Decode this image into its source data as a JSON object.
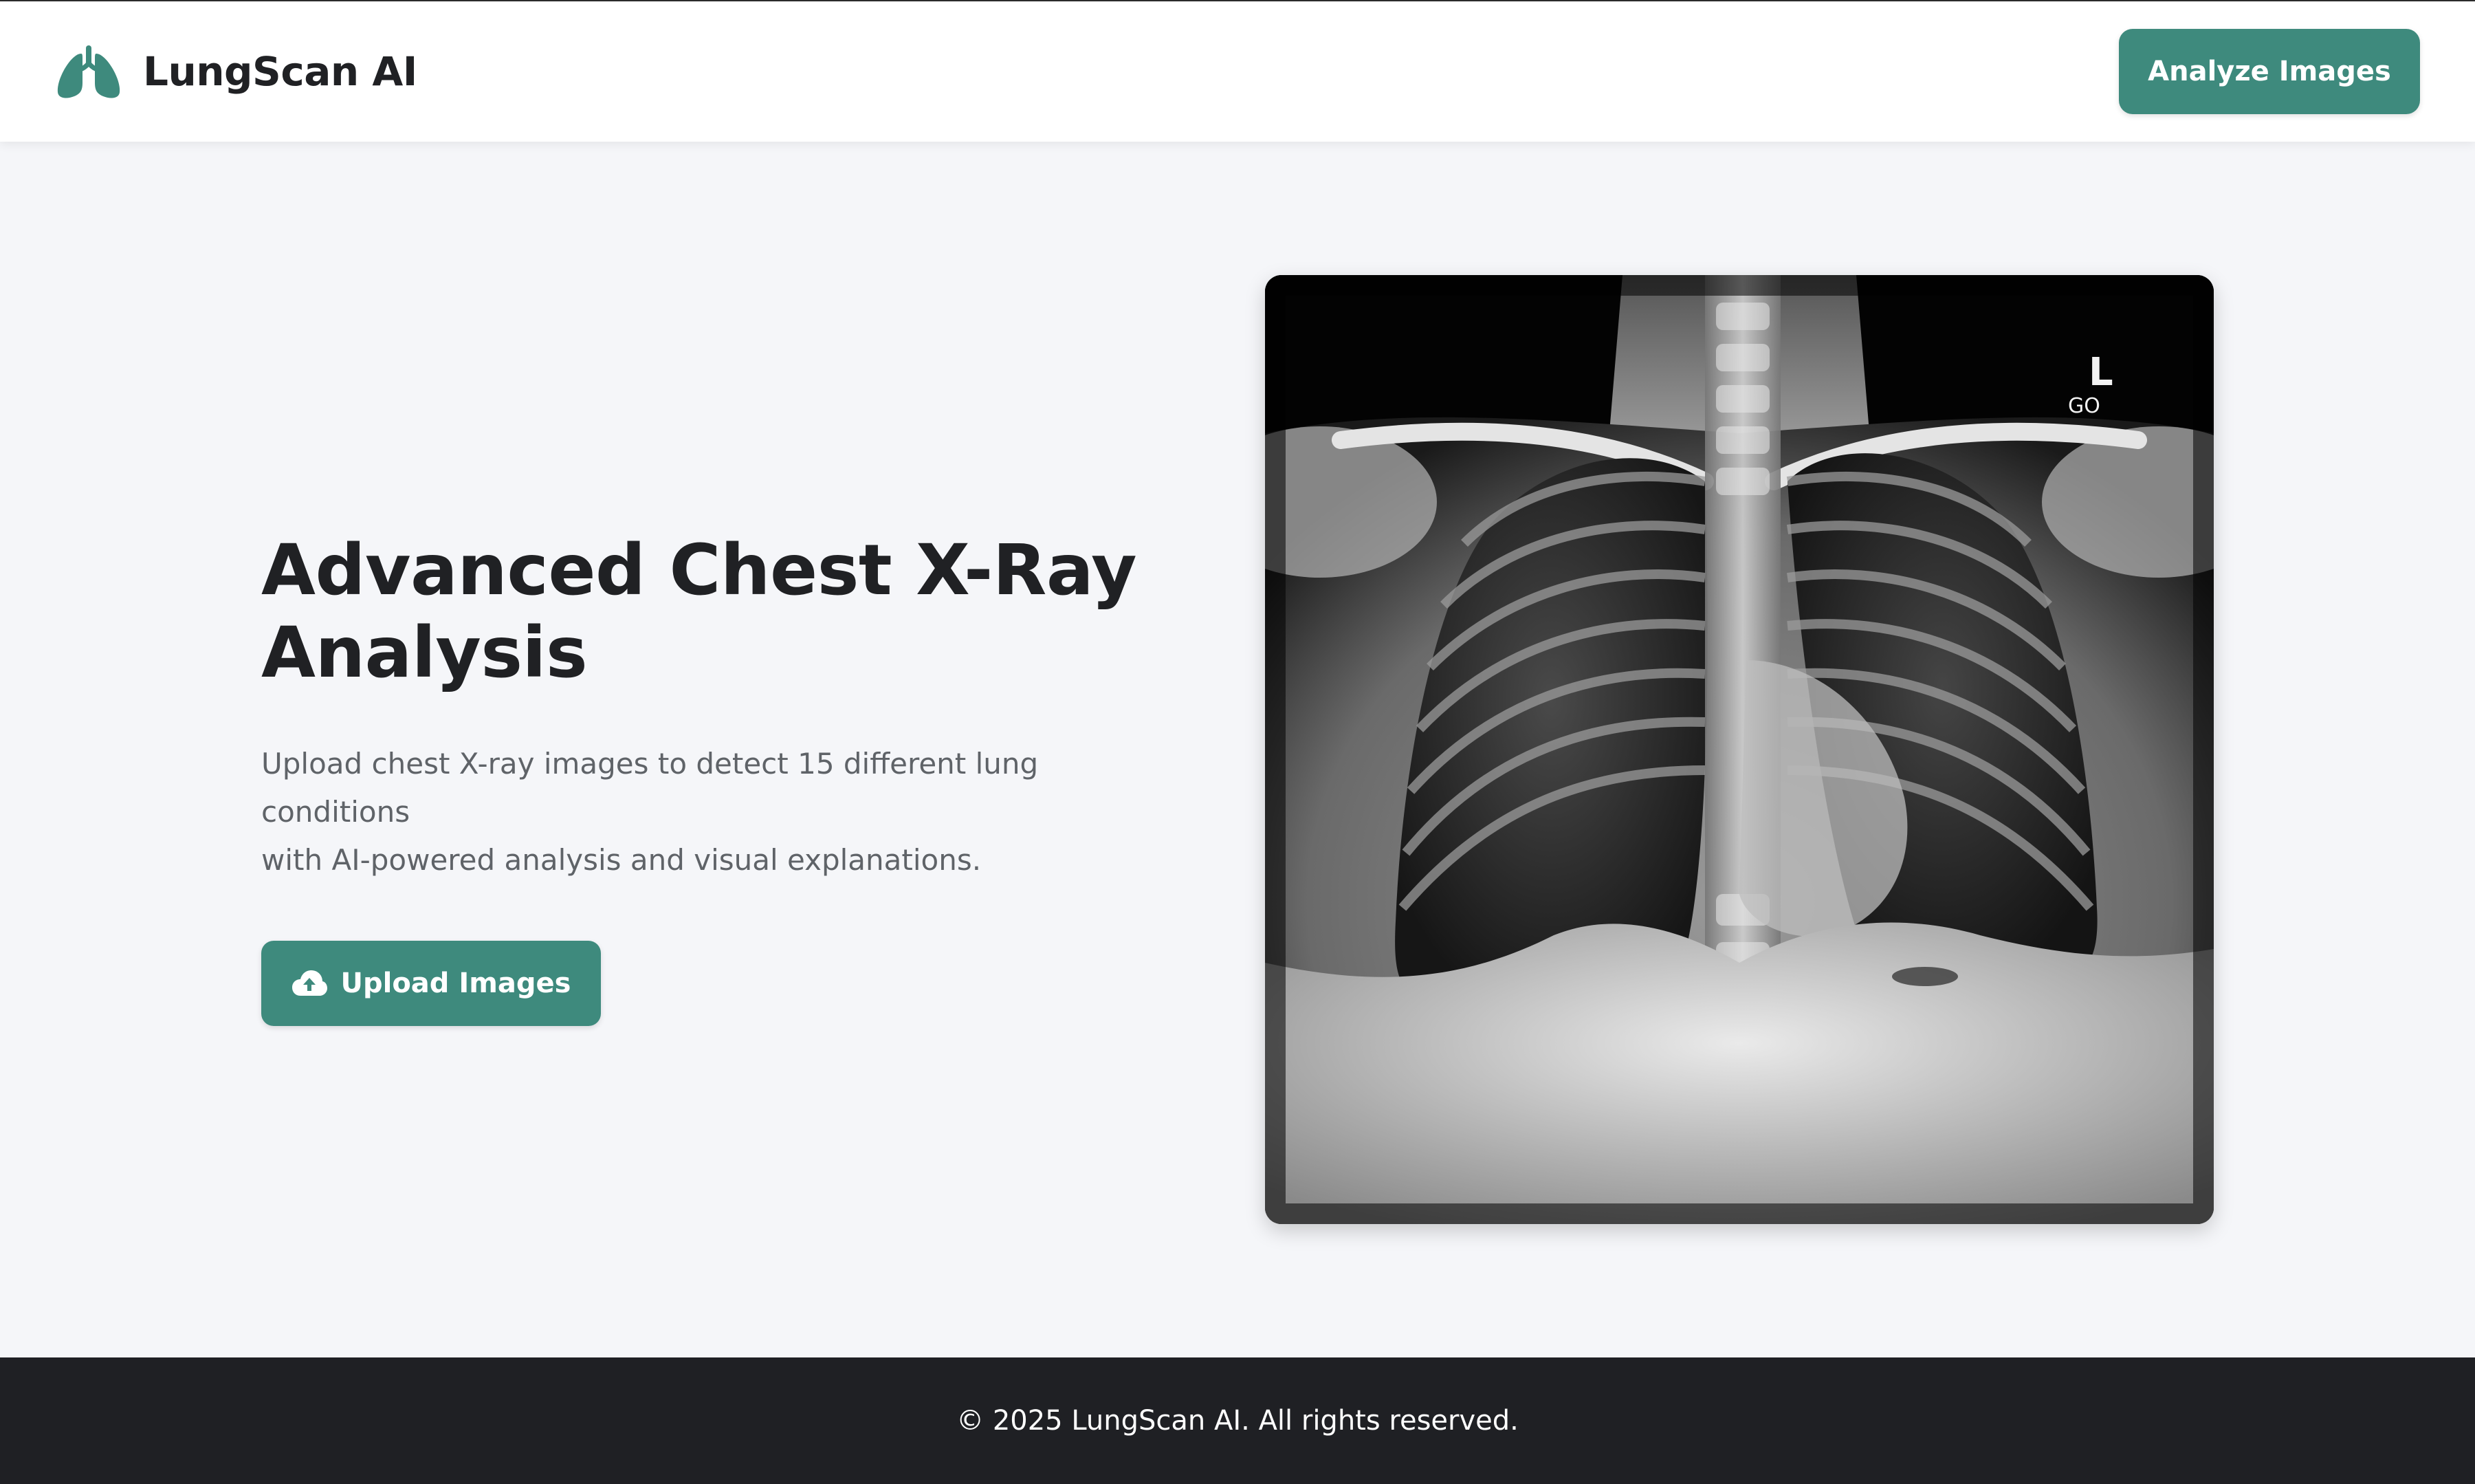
{
  "header": {
    "brand_name": "LungScan AI",
    "brand_icon": "lungs-icon",
    "analyze_button_label": "Analyze Images"
  },
  "hero": {
    "title_line1": "Advanced Chest X-Ray",
    "title_line2": "Analysis",
    "subtitle_line1": "Upload chest X-ray images to detect 15 different lung conditions",
    "subtitle_line2": "with AI-powered analysis and visual explanations.",
    "upload_button_label": "Upload Images",
    "upload_icon": "cloud-upload-icon"
  },
  "xray_image": {
    "marker_text": "L",
    "marker_subtext": "GO"
  },
  "footer": {
    "copyright": "© 2025 LungScan AI. All rights reserved."
  },
  "colors": {
    "accent": "#3e8a7d",
    "page_background": "#f5f6f9",
    "header_background": "#ffffff",
    "footer_background": "#1f2024",
    "title_text": "#202124",
    "body_text": "#5f6368"
  }
}
